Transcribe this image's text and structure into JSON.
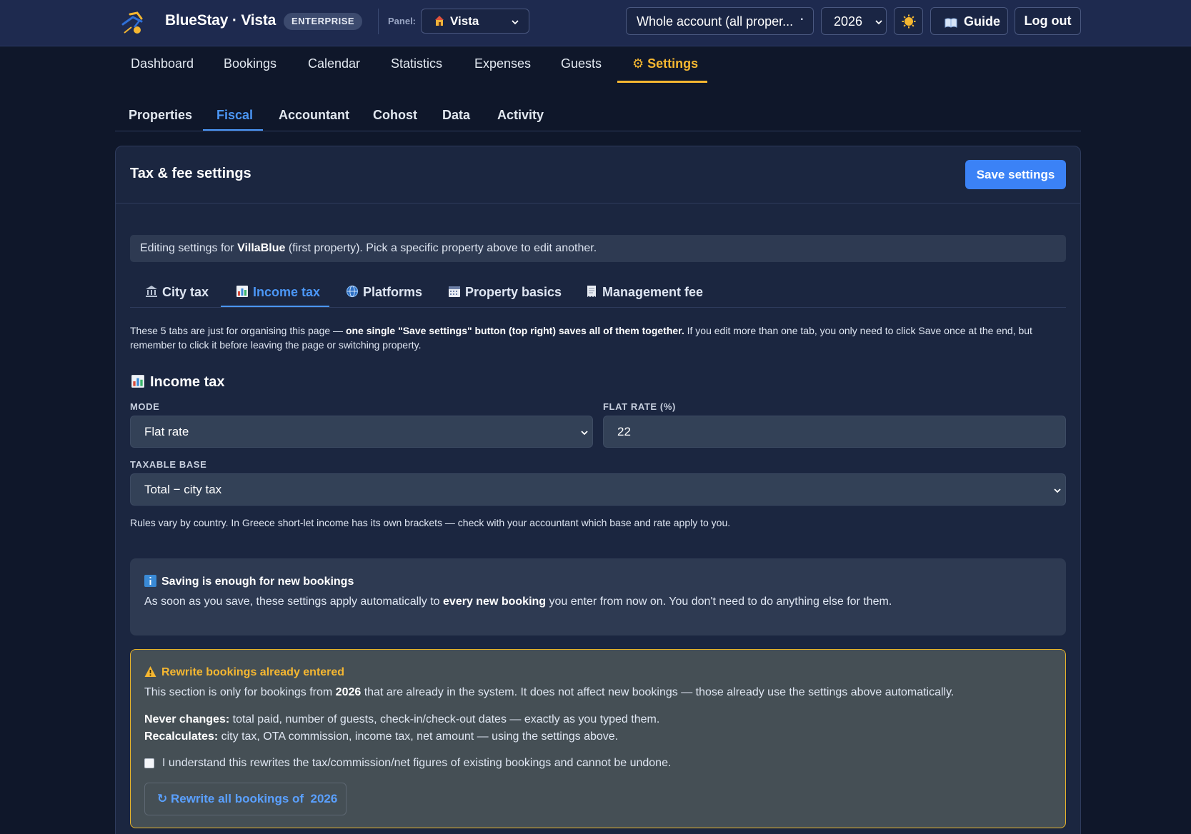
{
  "header": {
    "brand": "BlueStay · Vista",
    "edition_badge": "ENTERPRISE",
    "panel_label": "Panel:",
    "panel_value": "Vista",
    "account_select": "Whole account (all proper...",
    "year_select": "2026",
    "theme_icon": "sun-icon",
    "guide_label": "Guide",
    "logout_label": "Log out"
  },
  "main_nav": {
    "items": [
      "Dashboard",
      "Bookings",
      "Calendar",
      "Statistics",
      "Expenses",
      "Guests",
      "Settings"
    ],
    "active": "Settings",
    "active_color": "#f5b731"
  },
  "sub_nav": {
    "items": [
      "Properties",
      "Fiscal",
      "Accountant",
      "Cohost",
      "Data",
      "Activity"
    ],
    "active": "Fiscal",
    "active_color": "#4b96f5"
  },
  "card": {
    "title": "Tax & fee settings",
    "save_label": "Save settings",
    "info_prefix": "Editing settings for ",
    "info_property": "VillaBlue",
    "info_suffix": " (first property). Pick a specific property above to edit another.",
    "tabs": [
      {
        "label": "City tax",
        "icon": "bank-icon"
      },
      {
        "label": "Income tax",
        "icon": "bar-chart-icon"
      },
      {
        "label": "Platforms",
        "icon": "globe-icon"
      },
      {
        "label": "Property basics",
        "icon": "calendar-icon"
      },
      {
        "label": "Management fee",
        "icon": "receipt-icon"
      }
    ],
    "active_tab": "Income tax",
    "note_part1": "These 5 tabs are just for organising this page — ",
    "note_bold": "one single \"Save settings\" button (top right) saves all of them together.",
    "note_part2": " If you edit more than one tab, you only need to click Save once at the end, but remember to click it before leaving the page or switching property."
  },
  "income_tax": {
    "heading": "Income tax",
    "mode_label": "MODE",
    "mode_value": "Flat rate",
    "rate_label": "FLAT RATE (%)",
    "rate_value": "22",
    "base_label": "TAXABLE BASE",
    "base_value": "Total − city tax",
    "rules_note": "Rules vary by country. In Greece short-let income has its own brackets — check with your accountant which base and rate apply to you."
  },
  "saving_box": {
    "title": "Saving is enough for new bookings",
    "text_prefix": "As soon as you save, these settings apply automatically to ",
    "text_bold": "every new booking",
    "text_suffix": " you enter from now on. You don't need to do anything else for them."
  },
  "rewrite_box": {
    "title": "Rewrite bookings already entered",
    "line1_prefix": "This section is only for bookings from ",
    "line1_year": "2026",
    "line1_suffix": " that are already in the system. It does not affect new bookings — those already use the settings above automatically.",
    "never_label": "Never changes:",
    "never_text": " total paid, number of guests, check-in/check-out dates — exactly as you typed them.",
    "recalc_label": "Recalculates:",
    "recalc_text": " city tax, OTA commission, income tax, net amount — using the settings above.",
    "confirm_label": "I understand this rewrites the tax/commission/net figures of existing bookings and cannot be undone.",
    "confirm_checked": false,
    "button_label": "Rewrite all bookings of",
    "button_year": "2026",
    "warn_color": "#f5b731"
  }
}
